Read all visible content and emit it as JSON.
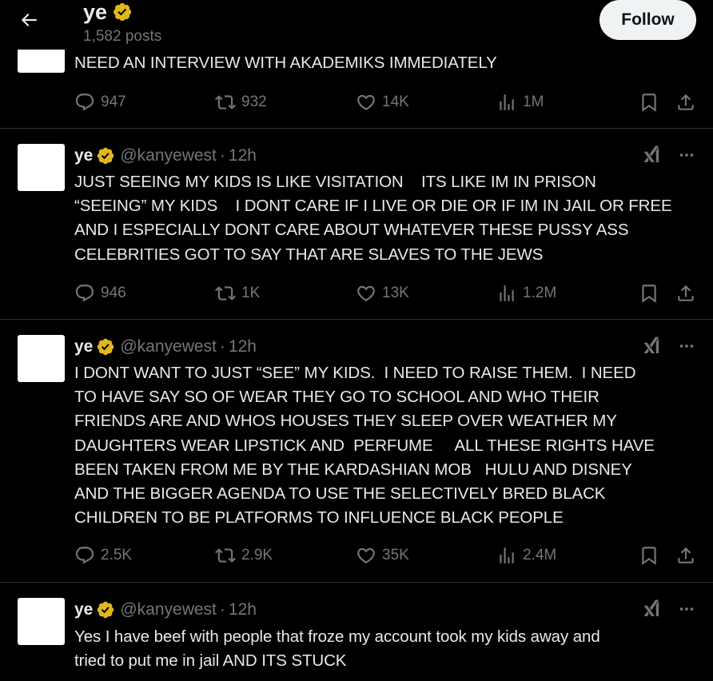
{
  "header": {
    "name": "ye",
    "posts": "1,582 posts",
    "follow_label": "Follow"
  },
  "tweets": [
    {
      "text": "NEED AN INTERVIEW WITH AKADEMIKS IMMEDIATELY",
      "replies": "947",
      "reposts": "932",
      "likes": "14K",
      "views": "1M"
    },
    {
      "name": "ye",
      "handle": "@kanyewest",
      "dot": "·",
      "time": "12h",
      "text": "JUST SEEING MY KIDS IS LIKE VISITATION    ITS LIKE IM IN PRISON\n“SEEING” MY KIDS    I DONT CARE IF I LIVE OR DIE OR IF IM IN JAIL OR FREE\nAND I ESPECIALLY DONT CARE ABOUT WHATEVER THESE PUSSY ASS\nCELEBRITIES GOT TO SAY THAT ARE SLAVES TO THE JEWS",
      "replies": "946",
      "reposts": "1K",
      "likes": "13K",
      "views": "1.2M"
    },
    {
      "name": "ye",
      "handle": "@kanyewest",
      "dot": "·",
      "time": "12h",
      "text": "I DONT WANT TO JUST “SEE” MY KIDS.  I NEED TO RAISE THEM.  I NEED\nTO HAVE SAY SO OF WEAR THEY GO TO SCHOOL AND WHO THEIR\nFRIENDS ARE AND WHOS HOUSES THEY SLEEP OVER WEATHER MY\nDAUGHTERS WEAR LIPSTICK AND  PERFUME     ALL THESE RIGHTS HAVE\nBEEN TAKEN FROM ME BY THE KARDASHIAN MOB   HULU AND DISNEY\nAND THE BIGGER AGENDA TO USE THE SELECTIVELY BRED BLACK\nCHILDREN TO BE PLATFORMS TO INFLUENCE BLACK PEOPLE",
      "replies": "2.5K",
      "reposts": "2.9K",
      "likes": "35K",
      "views": "2.4M"
    },
    {
      "name": "ye",
      "handle": "@kanyewest",
      "dot": "·",
      "time": "12h",
      "text": "Yes I have beef with people that froze my account took my kids away and\ntried to put me in jail AND ITS STUCK"
    }
  ],
  "icons": {
    "back": "arrow-left-icon",
    "verified": "verified-badge-icon",
    "grok": "grok-icon",
    "more": "more-dots-icon",
    "reply": "reply-icon",
    "repost": "repost-icon",
    "like": "like-icon",
    "views": "views-icon",
    "bookmark": "bookmark-icon",
    "share": "share-icon"
  },
  "colors": {
    "background": "#000000",
    "text": "#e7e9ea",
    "muted": "#71767b",
    "verified": "#e2b719",
    "divider": "#2f3336"
  }
}
